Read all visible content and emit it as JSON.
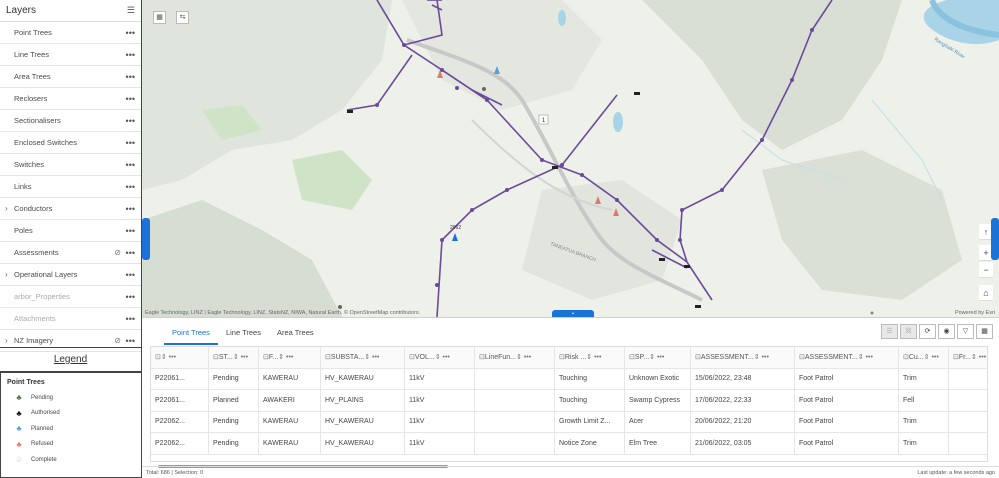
{
  "layers_panel": {
    "title": "Layers",
    "items": [
      {
        "label": "Point Trees",
        "expand": false,
        "eye": false,
        "dim": false
      },
      {
        "label": "Line Trees",
        "expand": false,
        "eye": false,
        "dim": false
      },
      {
        "label": "Area Trees",
        "expand": false,
        "eye": false,
        "dim": false
      },
      {
        "label": "Reclosers",
        "expand": false,
        "eye": false,
        "dim": false
      },
      {
        "label": "Sectionalisers",
        "expand": false,
        "eye": false,
        "dim": false
      },
      {
        "label": "Enclosed Switches",
        "expand": false,
        "eye": false,
        "dim": false
      },
      {
        "label": "Switches",
        "expand": false,
        "eye": false,
        "dim": false
      },
      {
        "label": "Links",
        "expand": false,
        "eye": false,
        "dim": false
      },
      {
        "label": "Conductors",
        "expand": true,
        "eye": false,
        "dim": false
      },
      {
        "label": "Poles",
        "expand": false,
        "eye": false,
        "dim": false
      },
      {
        "label": "Assessments",
        "expand": false,
        "eye": true,
        "dim": false
      },
      {
        "label": "Operational Layers",
        "expand": true,
        "eye": false,
        "dim": false
      },
      {
        "label": "arbor_Properties",
        "expand": false,
        "eye": false,
        "dim": true
      },
      {
        "label": "Attachments",
        "expand": false,
        "eye": false,
        "dim": true
      },
      {
        "label": "NZ Imagery",
        "expand": true,
        "eye": true,
        "dim": false
      }
    ]
  },
  "legend": {
    "header": "Legend",
    "title": "Point Trees",
    "items": [
      {
        "label": "Pending",
        "color": "#4a7a45",
        "glyph": "♣"
      },
      {
        "label": "Authorised",
        "color": "#111111",
        "glyph": "♣"
      },
      {
        "label": "Planned",
        "color": "#5aa0d8",
        "glyph": "♣"
      },
      {
        "label": "Refused",
        "color": "#e07a70",
        "glyph": "♣"
      },
      {
        "label": "Complete",
        "color": "#bfbfbf",
        "glyph": "♧"
      }
    ]
  },
  "map": {
    "attribution": "Eagle Technology, LINZ | Eagle Technology, LINZ, StatsNZ, NIWA, Natural Earth, © OpenStreetMap contributors.",
    "powered": "Powered by Esri",
    "road_label": "1",
    "callout": "2962",
    "branch_label": "TANEATUA BRANCH",
    "river_label": "Rangitaiki River",
    "line_color": "#6b4a9a"
  },
  "table": {
    "tabs": [
      "Point Trees",
      "Line Trees",
      "Area Trees"
    ],
    "active_tab": "Point Trees",
    "columns": [
      "",
      "ST...",
      "F...",
      "SUBSTA...",
      "VOL...",
      "LineFun...",
      "Risk ...",
      "SP...",
      "ASSESSMENT...",
      "ASSESSMENT...",
      "Cu...",
      "Fr..."
    ],
    "rows": [
      [
        "P22061...",
        "Pending",
        "KAWERAU",
        "HV_KAWERAU",
        "11kV",
        "",
        "Touching",
        "Unknown Exotic",
        "15/06/2022, 23:48",
        "Foot Patrol",
        "Trim",
        ""
      ],
      [
        "P22061...",
        "Planned",
        "AWAKERI",
        "HV_PLAINS",
        "11kV",
        "",
        "Touching",
        "Swamp Cypress",
        "17/06/2022, 22:33",
        "Foot Patrol",
        "Fell",
        ""
      ],
      [
        "P22062...",
        "Pending",
        "KAWERAU",
        "HV_KAWERAU",
        "11kV",
        "",
        "Growth Limit Z...",
        "Acer",
        "20/06/2022, 21:20",
        "Foot Patrol",
        "Trim",
        ""
      ],
      [
        "P22062...",
        "Pending",
        "KAWERAU",
        "HV_KAWERAU",
        "11kV",
        "",
        "Notice Zone",
        "Elm Tree",
        "21/06/2022, 03:05",
        "Foot Patrol",
        "Trim",
        ""
      ]
    ],
    "total": "Total: 686 | Selection: 0",
    "last_update": "Last update: a few seconds ago"
  }
}
